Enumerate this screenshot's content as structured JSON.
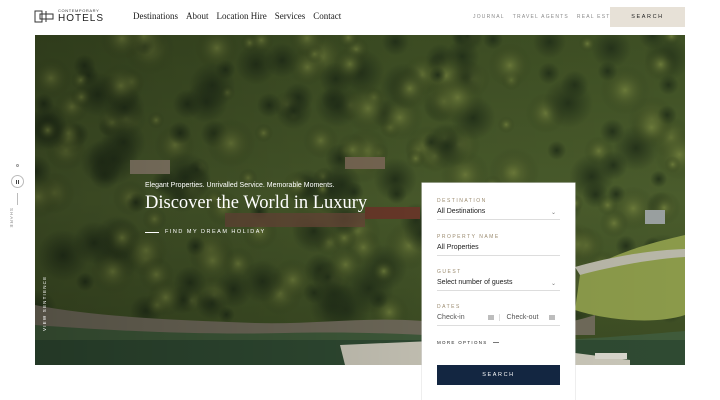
{
  "brand": {
    "small": "CONTEMPORARY",
    "big": "HOTELS"
  },
  "nav": [
    "Destinations",
    "About",
    "Location Hire",
    "Services",
    "Contact"
  ],
  "subnav": [
    "JOURNAL",
    "TRAVEL AGENTS",
    "REAL ESTATE"
  ],
  "header_search_label": "SEARCH",
  "hero": {
    "tagline": "Elegant Properties. Unrivalled Service. Memorable Moments.",
    "headline": "Discover the World in Luxury",
    "cta": "FIND MY DREAM HOLIDAY",
    "side_label": "VIEW SENTIENCE"
  },
  "share": {
    "label": "SHARE"
  },
  "search_panel": {
    "destination_label": "DESTINATION",
    "destination_value": "All Destinations",
    "property_label": "PROPERTY NAME",
    "property_value": "All Properties",
    "guest_label": "GUEST",
    "guest_value": "Select number of guests",
    "dates_label": "DATES",
    "checkin": "Check-in",
    "checkout": "Check-out",
    "more_options": "MORE OPTIONS",
    "search_label": "SEARCH"
  },
  "colors": {
    "accent_navy": "#132641",
    "header_search_bg": "#e7e1d7",
    "label_gold": "#9a8a6e"
  },
  "icons": [
    "logo-mark-icon",
    "pause-icon",
    "chevron-down-icon",
    "calendar-icon"
  ]
}
